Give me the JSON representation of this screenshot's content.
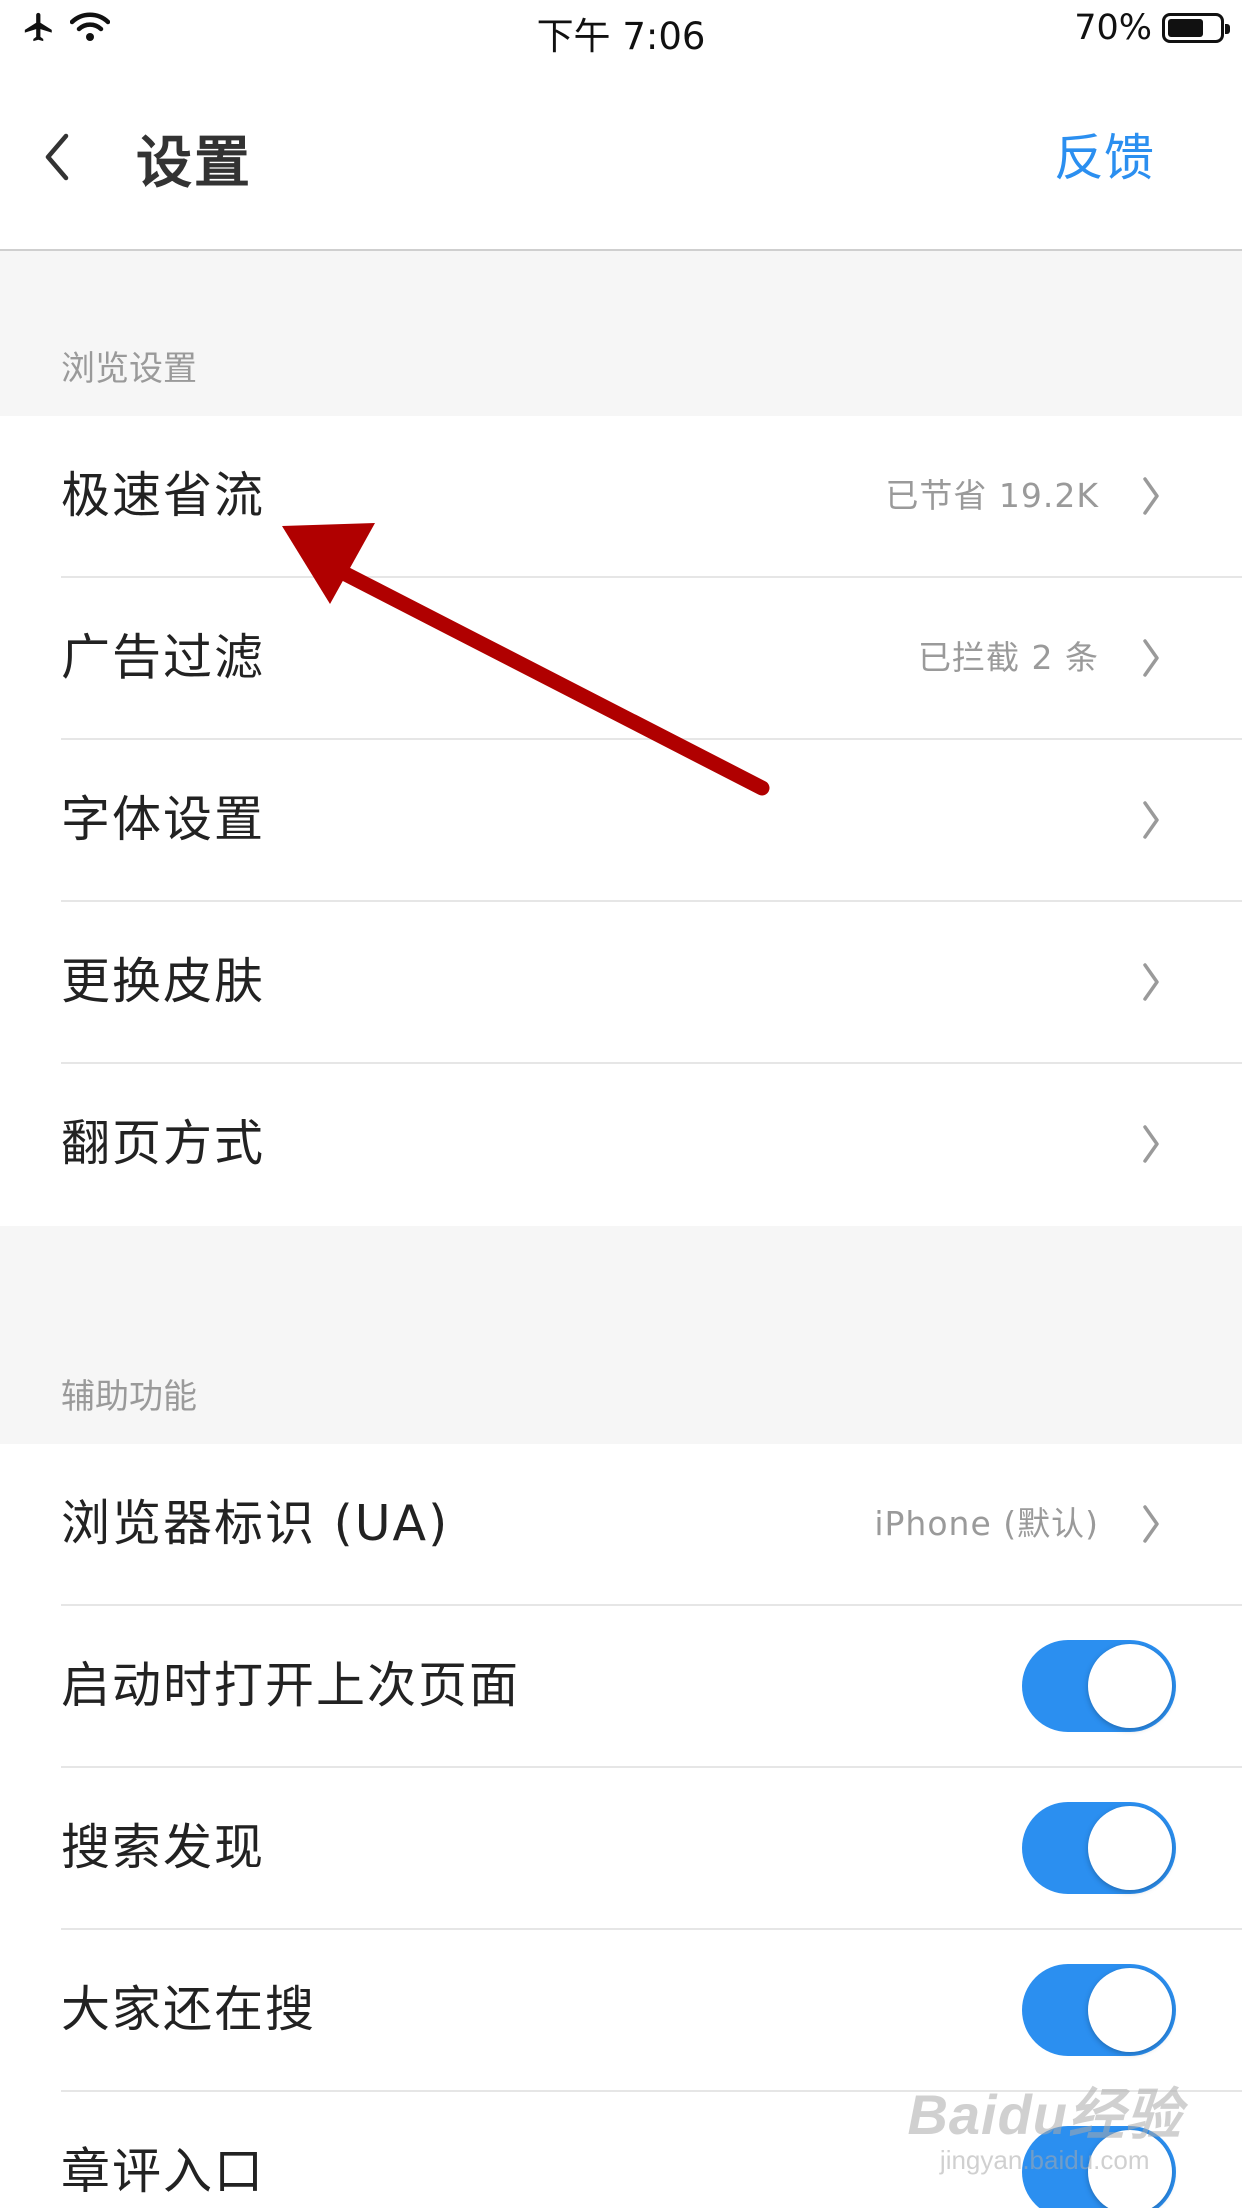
{
  "status_bar": {
    "time": "下午 7:06",
    "battery_percent": "70%",
    "battery_level": 0.7,
    "icons": [
      "airplane-icon",
      "wifi-icon",
      "battery-icon"
    ]
  },
  "header": {
    "title": "设置",
    "feedback_label": "反馈",
    "accent_color": "#2b8ff0"
  },
  "sections": {
    "browsing": {
      "title": "浏览设置",
      "items": [
        {
          "label": "极速省流",
          "value": "已节省 19.2K"
        },
        {
          "label": "广告过滤",
          "value": "已拦截 2 条"
        },
        {
          "label": "字体设置",
          "value": ""
        },
        {
          "label": "更换皮肤",
          "value": ""
        },
        {
          "label": "翻页方式",
          "value": ""
        }
      ]
    },
    "accessibility": {
      "title": "辅助功能",
      "items": [
        {
          "label": "浏览器标识 (UA)",
          "value": "iPhone (默认)"
        },
        {
          "label": "启动时打开上次页面",
          "toggle_on": true
        },
        {
          "label": "搜索发现",
          "toggle_on": true
        },
        {
          "label": "大家还在搜",
          "toggle_on": true
        },
        {
          "label": "章评入口",
          "toggle_on": true
        }
      ]
    }
  },
  "annotation": {
    "arrow_color": "#b00000"
  },
  "watermark": {
    "logo": "Baidu经验",
    "url": "jingyan.baidu.com"
  }
}
